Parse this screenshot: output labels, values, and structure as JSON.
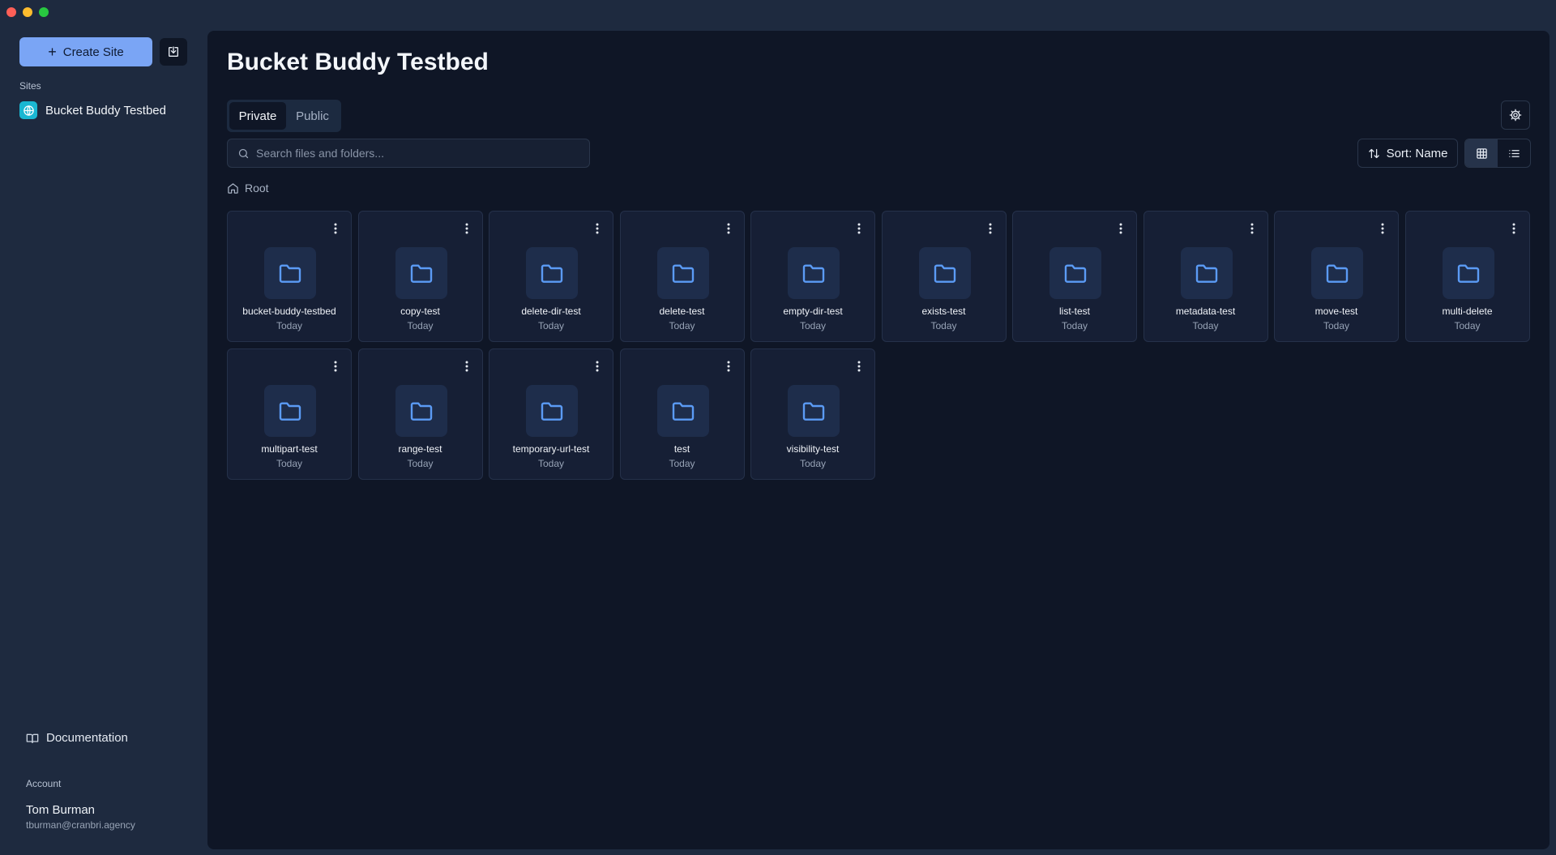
{
  "app": {
    "create_site_label": "Create Site"
  },
  "sidebar": {
    "sites_heading": "Sites",
    "sites": [
      {
        "label": "Bucket Buddy Testbed"
      }
    ],
    "documentation_label": "Documentation",
    "account_heading": "Account",
    "user_name": "Tom Burman",
    "user_email": "tburman@cranbri.agency"
  },
  "main": {
    "title": "Bucket Buddy Testbed",
    "tabs": [
      {
        "label": "Private",
        "active": true
      },
      {
        "label": "Public",
        "active": false
      }
    ],
    "search_placeholder": "Search files and folders...",
    "sort_label": "Sort: Name",
    "view_mode": "grid",
    "breadcrumb_root": "Root"
  },
  "folders": [
    {
      "name": "bucket-buddy-testbed",
      "date": "Today"
    },
    {
      "name": "copy-test",
      "date": "Today"
    },
    {
      "name": "delete-dir-test",
      "date": "Today"
    },
    {
      "name": "delete-test",
      "date": "Today"
    },
    {
      "name": "empty-dir-test",
      "date": "Today"
    },
    {
      "name": "exists-test",
      "date": "Today"
    },
    {
      "name": "list-test",
      "date": "Today"
    },
    {
      "name": "metadata-test",
      "date": "Today"
    },
    {
      "name": "move-test",
      "date": "Today"
    },
    {
      "name": "multi-delete",
      "date": "Today"
    },
    {
      "name": "multipart-test",
      "date": "Today"
    },
    {
      "name": "range-test",
      "date": "Today"
    },
    {
      "name": "temporary-url-test",
      "date": "Today"
    },
    {
      "name": "test",
      "date": "Today"
    },
    {
      "name": "visibility-test",
      "date": "Today"
    }
  ],
  "icons": {
    "folder": "folder-icon",
    "menu": "more-vertical-icon",
    "search": "search-icon",
    "settings": "gear-icon",
    "sort": "sort-arrows-icon",
    "grid_view": "grid-icon",
    "list_view": "list-icon",
    "home": "home-icon",
    "site": "globe-icon",
    "documentation": "book-icon",
    "import": "import-icon"
  },
  "colors": {
    "accent": "#7aa5f5",
    "folder_icon": "#5b9bf5",
    "site_icon_bg": "#1ab7d2",
    "window_bg": "#1e2a3f",
    "panel_bg": "#0f1626"
  }
}
